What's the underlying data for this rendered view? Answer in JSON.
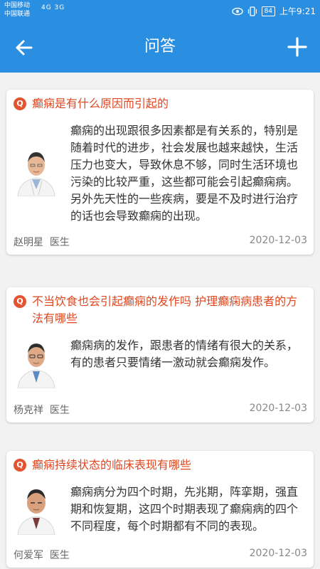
{
  "status_bar": {
    "carrier_1": "中国移动",
    "carrier_2": "中国联通",
    "signal_left": "4G 3G",
    "battery": "84",
    "time": "上午9:21"
  },
  "header": {
    "title": "问答",
    "back_icon": "arrow-left-icon",
    "add_icon": "plus-icon"
  },
  "colors": {
    "primary": "#2a8fe0",
    "question": "#e0461f",
    "badge": "#e3532f"
  },
  "qa_list": [
    {
      "badge": "Q",
      "question": "癫痫是有什么原因而引起的",
      "answer": "癫痫的出现跟很多因素都是有关系的，特别是随着时代的进步，社会发展也越来越快，生活压力也变大，导致休息不够，同时生活环境也污染的比较严重，这些都可能会引起癫痫病。另外先天性的一些疾病，要是不及时进行治疗的话也会导致癫痫的出现。",
      "doctor": "赵明星",
      "role": "医生",
      "date": "2020-12-03"
    },
    {
      "badge": "Q",
      "question": "不当饮食也会引起癫痫的发作吗 护理癫痫病患者的方法有哪些",
      "answer": "癫痫病的发作，跟患者的情绪有很大的关系，有的患者只要情绪一激动就会癫痫发作。",
      "doctor": "杨克祥",
      "role": "医生",
      "date": "2020-12-03"
    },
    {
      "badge": "Q",
      "question": "癫痫持续状态的临床表现有哪些",
      "answer": "癫痫病分为四个时期，先兆期，阵挛期，强直期和恢复期，这四个时期表现了癫痫病的四个不同程度，每个时期都有不同的表现。",
      "doctor": "何爱军",
      "role": "医生",
      "date": "2020-12-03"
    }
  ]
}
